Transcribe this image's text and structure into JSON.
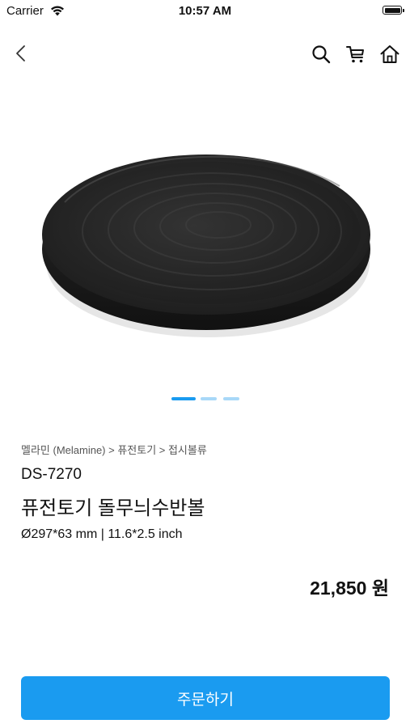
{
  "status_bar": {
    "carrier": "Carrier",
    "time": "10:57 AM"
  },
  "nav": {
    "back_icon": "chevron-left-icon",
    "icons": [
      "search-icon",
      "cart-icon",
      "home-icon"
    ]
  },
  "gallery": {
    "image": "black-melamine-plate",
    "page_count": 3,
    "current_page": 1
  },
  "product": {
    "breadcrumb": "멜라민 (Melamine) > 퓨전토기 > 접시볼류",
    "code": "DS-7270",
    "name": "퓨전토기 돌무늬수반볼",
    "size": "Ø297*63 mm | 11.6*2.5 inch",
    "price": "21,850 원"
  },
  "order_button": {
    "label": "주문하기"
  },
  "colors": {
    "accent": "#1a9bf0",
    "pager_inactive": "#a8d8f8",
    "text": "#111111"
  }
}
